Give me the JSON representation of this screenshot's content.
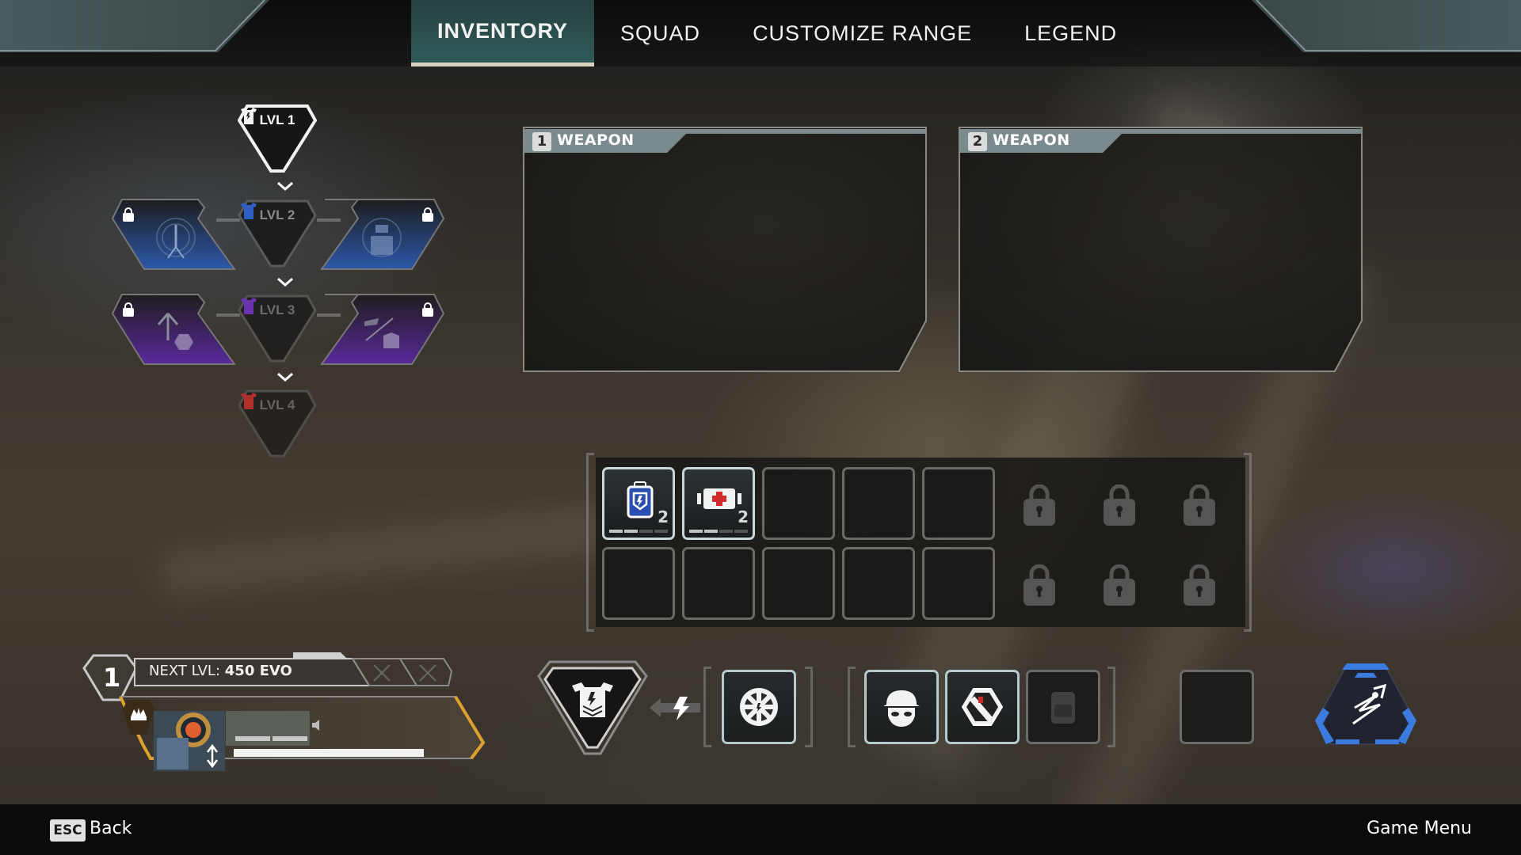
{
  "header": {
    "tabs": [
      {
        "label": "INVENTORY",
        "active": true
      },
      {
        "label": "SQUAD",
        "active": false
      },
      {
        "label": "CUSTOMIZE RANGE",
        "active": false
      },
      {
        "label": "LEGEND",
        "active": false
      }
    ]
  },
  "evo_tree": {
    "levels": [
      {
        "label": "LVL 1",
        "armor_color": "#ffffff",
        "unlocked": true
      },
      {
        "label": "LVL 2",
        "armor_color": "#2f5fc4",
        "unlocked": false
      },
      {
        "label": "LVL 3",
        "armor_color": "#7a3fc0",
        "unlocked": false
      },
      {
        "label": "LVL 4",
        "armor_color": "#c0302a",
        "unlocked": false
      }
    ],
    "perks": [
      {
        "level": 2,
        "side": "left",
        "icon": "beacon-scan-icon",
        "locked": true,
        "color": "#2f5fb0"
      },
      {
        "level": 2,
        "side": "right",
        "icon": "care-package-icon",
        "locked": true,
        "color": "#2f5fb0"
      },
      {
        "level": 3,
        "side": "left",
        "icon": "survey-beacon-icon",
        "locked": true,
        "color": "#6a2fb0"
      },
      {
        "level": 3,
        "side": "right",
        "icon": "drone-shield-icon",
        "locked": true,
        "color": "#6a2fb0"
      }
    ]
  },
  "weapons": [
    {
      "slot": "1",
      "label": "WEAPON"
    },
    {
      "slot": "2",
      "label": "WEAPON"
    }
  ],
  "backpack": {
    "items": [
      {
        "name": "Shield Cell",
        "icon": "shield-cell-icon",
        "count": "2",
        "stack_fill": 0.5,
        "color": "#2a4fb0"
      },
      {
        "name": "Syringe",
        "icon": "syringe-icon",
        "count": "2",
        "stack_fill": 0.5,
        "color": "#d02a2a"
      }
    ],
    "empty_slots": 8,
    "locked_slots": 6
  },
  "player": {
    "level": "1",
    "next_level_prefix": "NEXT LVL:",
    "next_level_value": "450 EVO",
    "health": 1.0,
    "shield_segments": 2,
    "accent": "#e0a030"
  },
  "equipment": {
    "body_armor": {
      "icon": "evo-armor-icon"
    },
    "upgrade": {
      "icon": "evo-cache-icon"
    },
    "helmet": {
      "icon": "helmet-icon"
    },
    "knockdown_shield": {
      "icon": "knockdown-shield-icon"
    },
    "backpack": {
      "icon": "backpack-icon",
      "empty": true
    },
    "survival_slot": {
      "empty": true
    },
    "tactical": {
      "icon": "tactical-ability-icon",
      "accent": "#3b7be0"
    }
  },
  "footer": {
    "back_key": "ESC",
    "back_label": "Back",
    "menu_label": "Game Menu"
  }
}
